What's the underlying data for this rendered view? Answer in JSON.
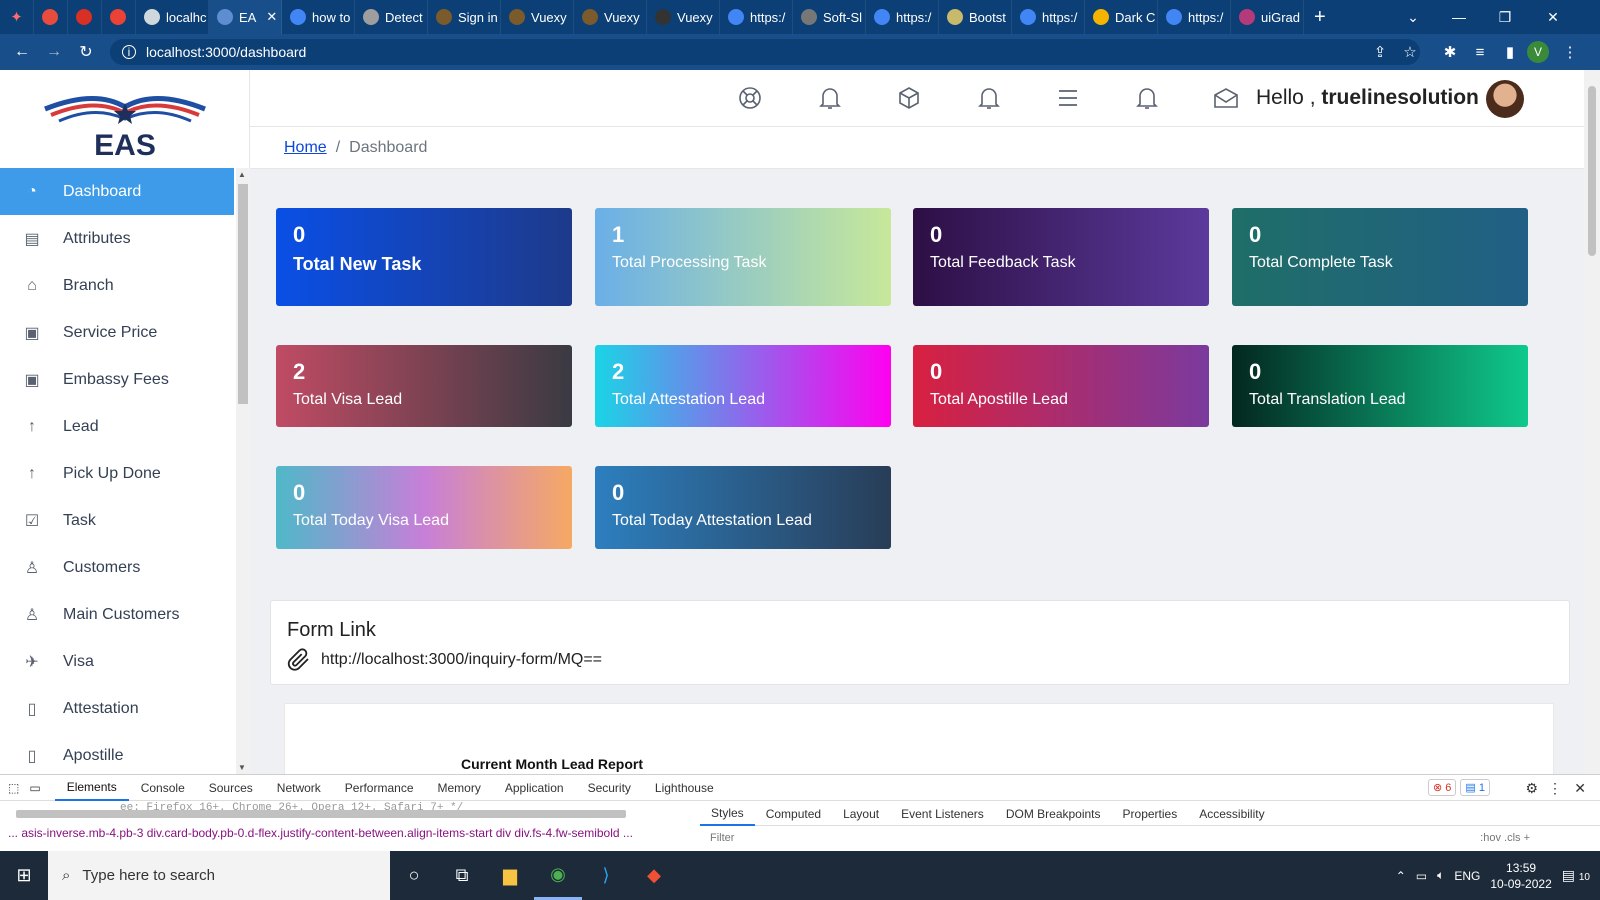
{
  "browser": {
    "tabs": [
      {
        "label": "",
        "fav": "#e74c3c"
      },
      {
        "label": "",
        "fav": "#d93025"
      },
      {
        "label": "",
        "fav": "#ea4335"
      },
      {
        "label": "localhc",
        "fav": "#cfd8dc"
      },
      {
        "label": "EA",
        "fav": "#5d8fd0",
        "active": true
      },
      {
        "label": "how to",
        "fav": "#4285f4"
      },
      {
        "label": "Detect",
        "fav": "#9e9e9e"
      },
      {
        "label": "Sign in",
        "fav": "#7b5b2b"
      },
      {
        "label": "Vuexy",
        "fav": "#7b5b2b"
      },
      {
        "label": "Vuexy",
        "fav": "#7b5b2b"
      },
      {
        "label": "Vuexy",
        "fav": "#333333"
      },
      {
        "label": "https:/",
        "fav": "#4285f4"
      },
      {
        "label": "Soft-Sl",
        "fav": "#777777"
      },
      {
        "label": "https:/",
        "fav": "#4285f4"
      },
      {
        "label": "Bootst",
        "fav": "#c8b96b"
      },
      {
        "label": "https:/",
        "fav": "#4285f4"
      },
      {
        "label": "Dark C",
        "fav": "#f4b400"
      },
      {
        "label": "https:/",
        "fav": "#4285f4"
      },
      {
        "label": "uiGrad",
        "fav": "#b53a7a"
      }
    ],
    "new_tab": "+",
    "url": "localhost:3000/dashboard",
    "profile_initial": "V"
  },
  "sidebar": {
    "logo_text": "EAS",
    "items": [
      {
        "label": "Dashboard",
        "icon": "dashboard-gauge-icon",
        "glyph": "◔",
        "active": true
      },
      {
        "label": "Attributes",
        "icon": "book-icon",
        "glyph": "▤"
      },
      {
        "label": "Branch",
        "icon": "bank-icon",
        "glyph": "⌂"
      },
      {
        "label": "Service Price",
        "icon": "receipt-icon",
        "glyph": "▣"
      },
      {
        "label": "Embassy Fees",
        "icon": "receipt-icon",
        "glyph": "▣"
      },
      {
        "label": "Lead",
        "icon": "arrow-up-icon",
        "glyph": "↑"
      },
      {
        "label": "Pick Up Done",
        "icon": "arrow-up-icon",
        "glyph": "↑"
      },
      {
        "label": "Task",
        "icon": "checkbox-icon",
        "glyph": "☑"
      },
      {
        "label": "Customers",
        "icon": "users-icon",
        "glyph": "♙"
      },
      {
        "label": "Main Customers",
        "icon": "users-icon",
        "glyph": "♙"
      },
      {
        "label": "Visa",
        "icon": "plane-icon",
        "glyph": "✈"
      },
      {
        "label": "Attestation",
        "icon": "document-icon",
        "glyph": "▯"
      },
      {
        "label": "Apostille",
        "icon": "document-icon",
        "glyph": "▯"
      }
    ]
  },
  "topbar": {
    "hello_prefix": "Hello ,",
    "username": "truelinesolution"
  },
  "breadcrumb": {
    "home": "Home",
    "current": "Dashboard"
  },
  "cards": [
    {
      "value": "0",
      "label": "Total New Task",
      "bg": "linear-gradient(90deg,#0a4fe6,#1e3a8a)"
    },
    {
      "value": "1",
      "label": "Total Processing Task",
      "bg": "linear-gradient(90deg,#6aafe8,#c7e89a)"
    },
    {
      "value": "0",
      "label": "Total Feedback Task",
      "bg": "linear-gradient(90deg,#2d0f45,#5b3a9c)"
    },
    {
      "value": "0",
      "label": "Total Complete Task",
      "bg": "linear-gradient(90deg,#1f6e68,#215f85)"
    },
    {
      "value": "2",
      "label": "Total Visa Lead",
      "bg": "linear-gradient(90deg,#c04b64,#3a3a42)"
    },
    {
      "value": "2",
      "label": "Total Attestation Lead",
      "bg": "linear-gradient(90deg,#1ad4e6,#ff00f0)"
    },
    {
      "value": "0",
      "label": "Total Apostille Lead",
      "bg": "linear-gradient(90deg,#d82040,#7a3a9e)"
    },
    {
      "value": "0",
      "label": "Total Translation Lead",
      "bg": "linear-gradient(90deg,#03271f,#0fc98c)"
    },
    {
      "value": "0",
      "label": "Total Today Visa Lead",
      "bg": "linear-gradient(90deg,#4fb8c8,#c77fd8,#f6a963)"
    },
    {
      "value": "0",
      "label": "Total Today Attestation Lead",
      "bg": "linear-gradient(90deg,#2d7fbf,#283d57)"
    }
  ],
  "form_link": {
    "title": "Form Link",
    "url": "http://localhost:3000/inquiry-form/MQ=="
  },
  "report": {
    "title": "Current Month Lead Report"
  },
  "devtools": {
    "tabs": [
      "Elements",
      "Console",
      "Sources",
      "Network",
      "Performance",
      "Memory",
      "Application",
      "Security",
      "Lighthouse"
    ],
    "errors": "6",
    "messages": "1",
    "code_line": "ee: Firefox 16+. Chrome 26+. Opera 12+. Safari 7+ */",
    "crumbs": "...  asis-inverse.mb-4.pb-3   div.card-body.pb-0.d-flex.justify-content-between.align-items-start   div   div.fs-4.fw-semibold   ...",
    "styles_tabs": [
      "Styles",
      "Computed",
      "Layout",
      "Event Listeners",
      "DOM Breakpoints",
      "Properties",
      "Accessibility"
    ],
    "filter_placeholder": "Filter",
    "pseudo": ":hov  .cls  +"
  },
  "taskbar": {
    "search_placeholder": "Type here to search",
    "language": "ENG",
    "time": "13:59",
    "date": "10-09-2022",
    "notifications": "10"
  }
}
